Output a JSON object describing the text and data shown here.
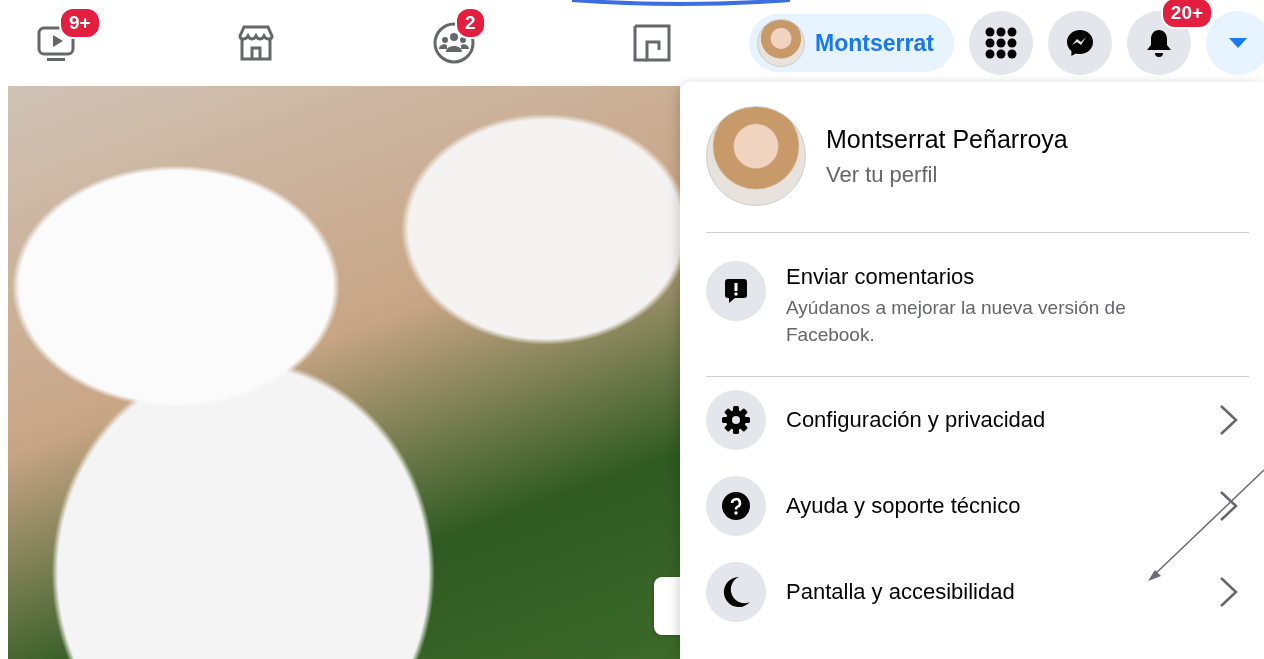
{
  "nav_tabs": [
    {
      "kind": "video",
      "badge": "9+"
    },
    {
      "kind": "store"
    },
    {
      "kind": "groups",
      "badge": "2"
    },
    {
      "kind": "gaming"
    }
  ],
  "profile_button": {
    "name": "Montserrat"
  },
  "actions": [
    {
      "kind": "menu"
    },
    {
      "kind": "messenger"
    },
    {
      "kind": "notifications",
      "badge": "20+"
    },
    {
      "kind": "account",
      "selected": true
    }
  ],
  "account_menu": {
    "name": "Montserrat Peñarroya",
    "subtitle": "Ver tu perfil",
    "feedback": {
      "title": "Enviar comentarios",
      "subtitle": "Ayúdanos a mejorar la nueva versión de Facebook."
    },
    "items": [
      {
        "kind": "settings",
        "label": "Configuración y privacidad"
      },
      {
        "kind": "help",
        "label": "Ayuda y soporte técnico"
      },
      {
        "kind": "display",
        "label": "Pantalla y accesibilidad"
      }
    ]
  }
}
